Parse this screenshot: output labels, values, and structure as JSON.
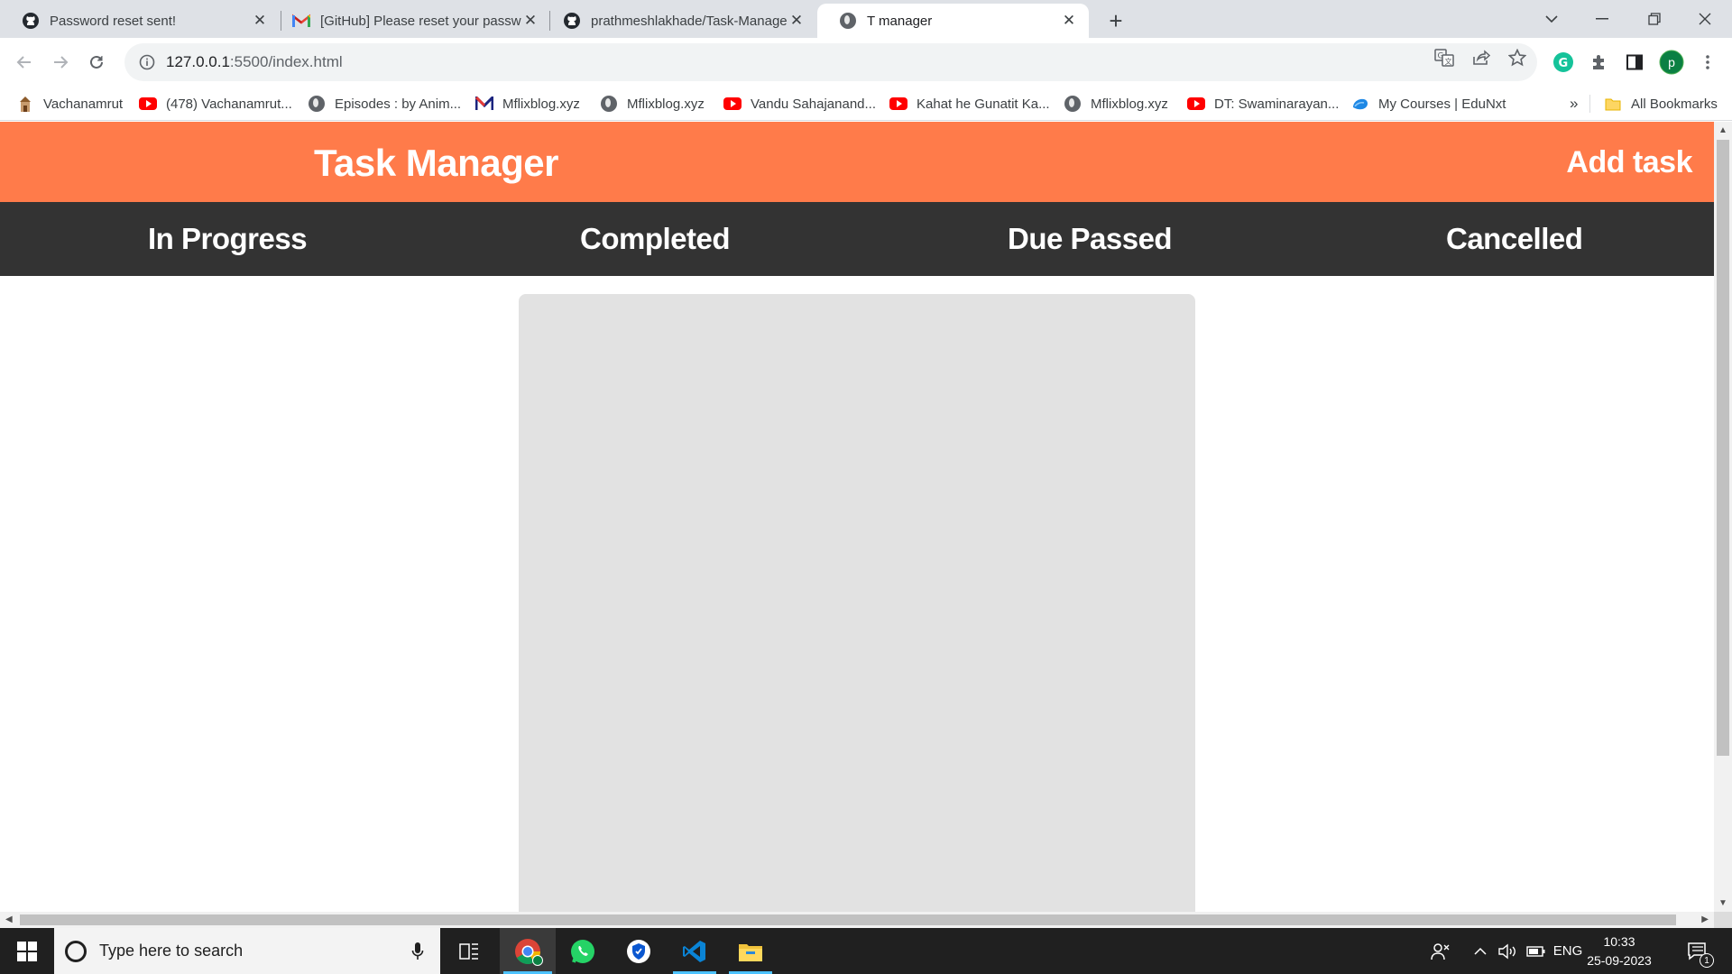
{
  "browser": {
    "tabs": [
      {
        "title": "Password reset sent!",
        "icon": "github-icon",
        "active": false
      },
      {
        "title": "[GitHub] Please reset your passw",
        "icon": "gmail-icon",
        "active": false
      },
      {
        "title": "prathmeshlakhade/Task-Manage",
        "icon": "github-icon",
        "active": false
      },
      {
        "title": "T manager",
        "icon": "globe-icon",
        "active": true
      }
    ],
    "url_host": "127.0.0.1",
    "url_rest": ":5500/index.html",
    "profile_initial": "P",
    "bookmarks": [
      {
        "label": "Vachanamrut",
        "icon": "vachanamrut-icon"
      },
      {
        "label": "(478) Vachanamrut...",
        "icon": "youtube-icon"
      },
      {
        "label": "Episodes : by Anim...",
        "icon": "globe-icon"
      },
      {
        "label": "Mflixblog.xyz",
        "icon": "mflix-icon"
      },
      {
        "label": "Mflixblog.xyz",
        "icon": "globe-icon"
      },
      {
        "label": "Vandu Sahajanand...",
        "icon": "youtube-icon"
      },
      {
        "label": "Kahat he Gunatit Ka...",
        "icon": "youtube-icon"
      },
      {
        "label": "Mflixblog.xyz",
        "icon": "globe-icon"
      },
      {
        "label": "DT: Swaminarayan...",
        "icon": "youtube-icon"
      },
      {
        "label": "My Courses | EduNxt",
        "icon": "edunxt-icon"
      }
    ],
    "bookmarks_overflow": "»",
    "all_bookmarks": "All Bookmarks"
  },
  "app": {
    "title": "Task Manager",
    "add_task": "Add task",
    "status_tabs": [
      "In Progress",
      "Completed",
      "Due Passed",
      "Cancelled"
    ]
  },
  "taskbar": {
    "search_placeholder": "Type here to search",
    "language": "ENG",
    "time": "10:33",
    "date": "25-09-2023",
    "notification_count": "1"
  },
  "colors": {
    "header": "#ff7b4a",
    "nav": "#333333",
    "panel": "#e2e2e2"
  }
}
